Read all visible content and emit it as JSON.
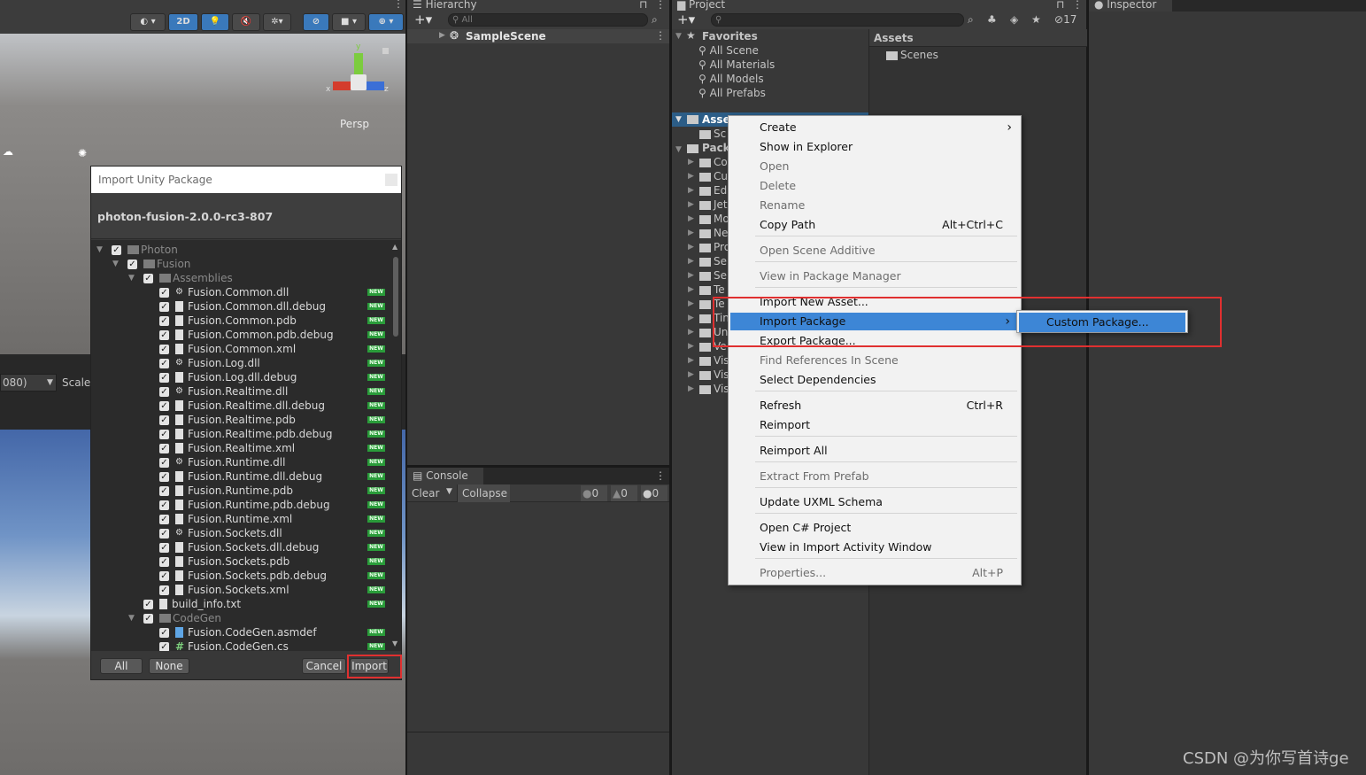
{
  "colors": {
    "accent": "#3d86d6",
    "highlight_box": "#e03030",
    "new_badge": "#2a9c3a"
  },
  "scene_view": {
    "toolbar": {
      "mode_2d": "2D"
    },
    "persp_label": "Persp",
    "gizmo": {
      "y": "y",
      "x": "x",
      "z": "z"
    }
  },
  "game_view": {
    "resolution": "080)",
    "scale_label": "Scale"
  },
  "hierarchy": {
    "tab_label": "Hierarchy",
    "search_placeholder": "All",
    "scene_name": "SampleScene"
  },
  "console": {
    "tab_label": "Console",
    "clear_label": "Clear",
    "collapse_label": "Collapse",
    "error_count": "0",
    "warning_count": "0",
    "info_count": "0"
  },
  "project": {
    "tab_label": "Project",
    "hidden_count": "17",
    "favorites": {
      "label": "Favorites",
      "items": [
        "All Scene",
        "All Materials",
        "All Models",
        "All Prefabs"
      ]
    },
    "assets_root": "Asse",
    "assets_children": [
      "Sc"
    ],
    "packages_root": "Pack",
    "package_items": [
      "Co",
      "Cu",
      "Edi",
      "Jet",
      "Mo",
      "Ne",
      "Pro",
      "Se",
      "Se",
      "Te",
      "Te",
      "Tin",
      "Un",
      "Ve",
      "Vis",
      "Vis",
      "Vis"
    ],
    "breadcrumb": "Assets",
    "folder_items": [
      "Scenes"
    ]
  },
  "inspector": {
    "tab_label": "Inspector"
  },
  "import_dialog": {
    "title": "Import Unity Package",
    "package_name": "photon-fusion-2.0.0-rc3-807",
    "new_badge": "NEW",
    "tree": [
      {
        "label": "Photon",
        "type": "folder",
        "depth": 0
      },
      {
        "label": "Fusion",
        "type": "folder",
        "depth": 1
      },
      {
        "label": "Assemblies",
        "type": "folder",
        "depth": 2
      },
      {
        "label": "Fusion.Common.dll",
        "type": "dll",
        "depth": 3
      },
      {
        "label": "Fusion.Common.dll.debug",
        "type": "file",
        "depth": 3
      },
      {
        "label": "Fusion.Common.pdb",
        "type": "file",
        "depth": 3
      },
      {
        "label": "Fusion.Common.pdb.debug",
        "type": "file",
        "depth": 3
      },
      {
        "label": "Fusion.Common.xml",
        "type": "file",
        "depth": 3
      },
      {
        "label": "Fusion.Log.dll",
        "type": "dll",
        "depth": 3
      },
      {
        "label": "Fusion.Log.dll.debug",
        "type": "file",
        "depth": 3
      },
      {
        "label": "Fusion.Realtime.dll",
        "type": "dll",
        "depth": 3
      },
      {
        "label": "Fusion.Realtime.dll.debug",
        "type": "file",
        "depth": 3
      },
      {
        "label": "Fusion.Realtime.pdb",
        "type": "file",
        "depth": 3
      },
      {
        "label": "Fusion.Realtime.pdb.debug",
        "type": "file",
        "depth": 3
      },
      {
        "label": "Fusion.Realtime.xml",
        "type": "file",
        "depth": 3
      },
      {
        "label": "Fusion.Runtime.dll",
        "type": "dll",
        "depth": 3
      },
      {
        "label": "Fusion.Runtime.dll.debug",
        "type": "file",
        "depth": 3
      },
      {
        "label": "Fusion.Runtime.pdb",
        "type": "file",
        "depth": 3
      },
      {
        "label": "Fusion.Runtime.pdb.debug",
        "type": "file",
        "depth": 3
      },
      {
        "label": "Fusion.Runtime.xml",
        "type": "file",
        "depth": 3
      },
      {
        "label": "Fusion.Sockets.dll",
        "type": "dll",
        "depth": 3
      },
      {
        "label": "Fusion.Sockets.dll.debug",
        "type": "file",
        "depth": 3
      },
      {
        "label": "Fusion.Sockets.pdb",
        "type": "file",
        "depth": 3
      },
      {
        "label": "Fusion.Sockets.pdb.debug",
        "type": "file",
        "depth": 3
      },
      {
        "label": "Fusion.Sockets.xml",
        "type": "file",
        "depth": 3
      },
      {
        "label": "build_info.txt",
        "type": "file",
        "depth": 2
      },
      {
        "label": "CodeGen",
        "type": "folder",
        "depth": 2
      },
      {
        "label": "Fusion.CodeGen.asmdef",
        "type": "asmdef",
        "depth": 3
      },
      {
        "label": "Fusion.CodeGen.cs",
        "type": "cs",
        "depth": 3
      }
    ],
    "buttons": {
      "all": "All",
      "none": "None",
      "cancel": "Cancel",
      "import": "Import"
    }
  },
  "context_menu": {
    "items": [
      {
        "label": "Create",
        "shortcut": "",
        "disabled": false,
        "submenu": true
      },
      {
        "label": "Show in Explorer",
        "shortcut": "",
        "disabled": false
      },
      {
        "label": "Open",
        "shortcut": "",
        "disabled": true
      },
      {
        "label": "Delete",
        "shortcut": "",
        "disabled": true
      },
      {
        "label": "Rename",
        "shortcut": "",
        "disabled": true
      },
      {
        "label": "Copy Path",
        "shortcut": "Alt+Ctrl+C",
        "disabled": false
      },
      {
        "label": "Open Scene Additive",
        "shortcut": "",
        "disabled": true
      },
      {
        "label": "View in Package Manager",
        "shortcut": "",
        "disabled": true
      },
      {
        "label": "Import New Asset...",
        "shortcut": "",
        "disabled": false
      },
      {
        "label": "Import Package",
        "shortcut": "",
        "disabled": false,
        "submenu": true,
        "highlighted": true
      },
      {
        "label": "Export Package...",
        "shortcut": "",
        "disabled": false
      },
      {
        "label": "Find References In Scene",
        "shortcut": "",
        "disabled": true
      },
      {
        "label": "Select Dependencies",
        "shortcut": "",
        "disabled": false
      },
      {
        "label": "Refresh",
        "shortcut": "Ctrl+R",
        "disabled": false
      },
      {
        "label": "Reimport",
        "shortcut": "",
        "disabled": false
      },
      {
        "label": "Reimport All",
        "shortcut": "",
        "disabled": false
      },
      {
        "label": "Extract From Prefab",
        "shortcut": "",
        "disabled": true
      },
      {
        "label": "Update UXML Schema",
        "shortcut": "",
        "disabled": false
      },
      {
        "label": "Open C# Project",
        "shortcut": "",
        "disabled": false
      },
      {
        "label": "View in Import Activity Window",
        "shortcut": "",
        "disabled": false
      },
      {
        "label": "Properties...",
        "shortcut": "Alt+P",
        "disabled": true
      }
    ],
    "submenu": {
      "items": [
        "Custom Package..."
      ]
    }
  },
  "watermark": "CSDN @为你写首诗ge"
}
